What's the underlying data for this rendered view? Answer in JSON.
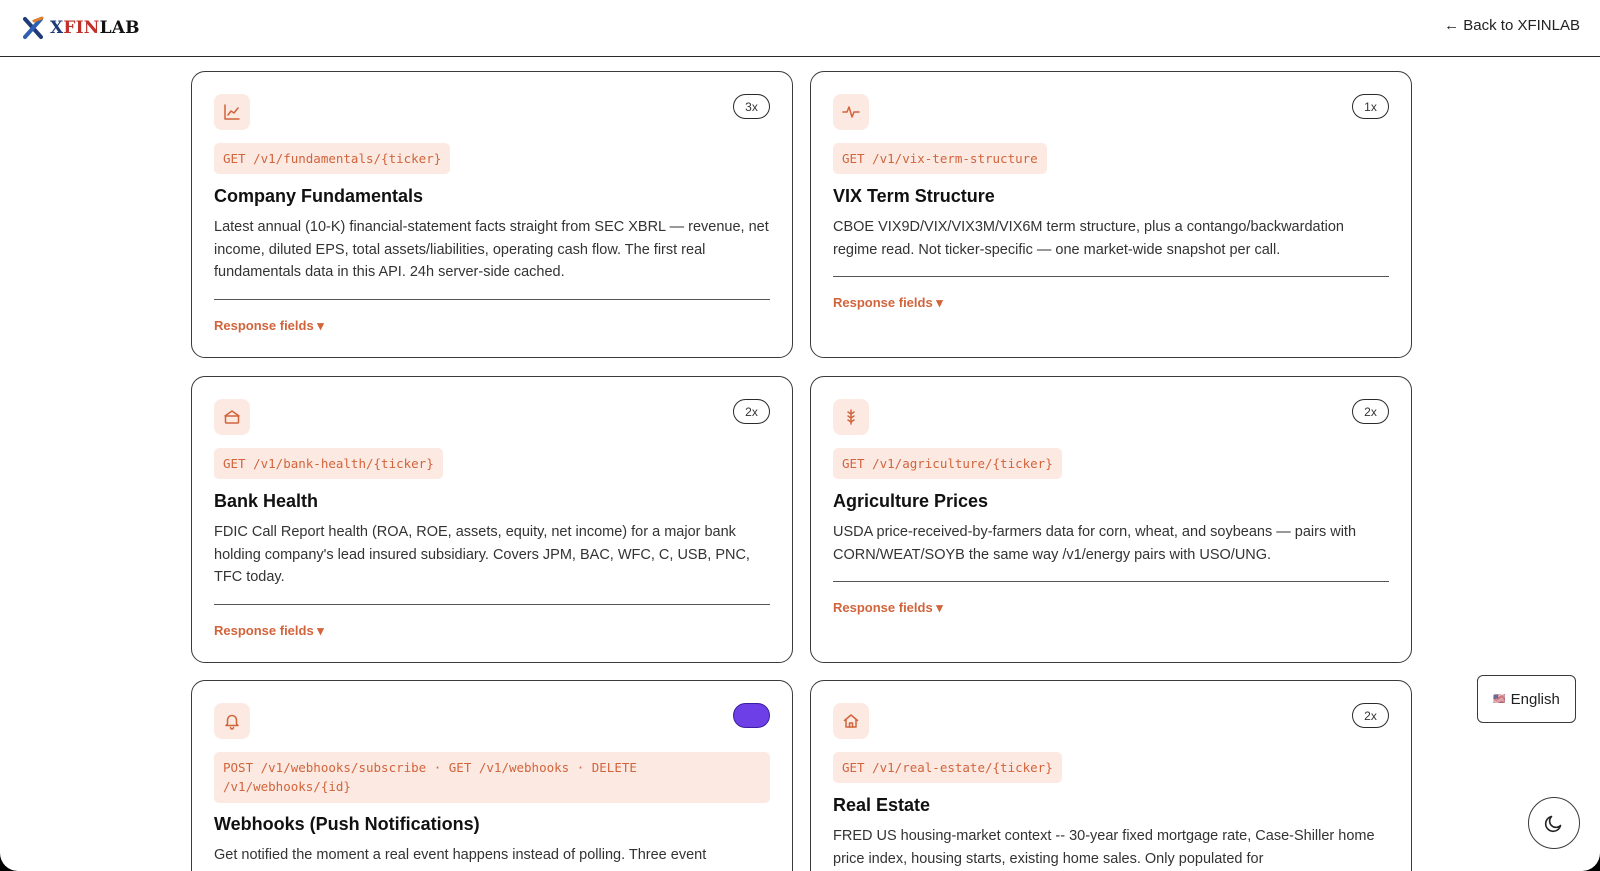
{
  "brand": {
    "name": "XFINLAB"
  },
  "nav": {
    "back_label": "← Back to XFINLAB"
  },
  "cards": [
    {
      "icon": "line-chart-icon",
      "badge": "3x",
      "endpoint": "GET /v1/fundamentals/{ticker}",
      "title": "Company Fundamentals",
      "description": "Latest annual (10-K) financial-statement facts straight from SEC XBRL — revenue, net income, diluted EPS, total assets/liabilities, operating cash flow. The first real fundamentals data in this API. 24h server-side cached.",
      "response_label": "Response fields ▾"
    },
    {
      "icon": "pulse-icon",
      "badge": "1x",
      "endpoint": "GET /v1/vix-term-structure",
      "title": "VIX Term Structure",
      "description": "CBOE VIX9D/VIX/VIX3M/VIX6M term structure, plus a contango/backwardation regime read. Not ticker-specific — one market-wide snapshot per call.",
      "response_label": "Response fields ▾"
    },
    {
      "icon": "bank-icon",
      "badge": "2x",
      "endpoint": "GET /v1/bank-health/{ticker}",
      "title": "Bank Health",
      "description": "FDIC Call Report health (ROA, ROE, assets, equity, net income) for a major bank holding company's lead insured subsidiary. Covers JPM, BAC, WFC, C, USB, PNC, TFC today.",
      "response_label": "Response fields ▾"
    },
    {
      "icon": "wheat-icon",
      "badge": "2x",
      "endpoint": "GET /v1/agriculture/{ticker}",
      "title": "Agriculture Prices",
      "description": "USDA price-received-by-farmers data for corn, wheat, and soybeans — pairs with CORN/WEAT/SOYB the same way /v1/energy pairs with USO/UNG.",
      "response_label": "Response fields ▾"
    },
    {
      "icon": "bell-icon",
      "badge": "",
      "endpoint": "POST /v1/webhooks/subscribe · GET /v1/webhooks · DELETE /v1/webhooks/{id}",
      "title": "Webhooks (Push Notifications)",
      "description": "Get notified the moment a real event happens instead of polling. Three event",
      "response_label": ""
    },
    {
      "icon": "house-icon",
      "badge": "2x",
      "endpoint": "GET /v1/real-estate/{ticker}",
      "title": "Real Estate",
      "description": "FRED US housing-market context -- 30-year fixed mortgage rate, Case-Shiller home price index, housing starts, existing home sales. Only populated for",
      "response_label": ""
    }
  ],
  "language": {
    "flag": "🇺🇸",
    "label": "English"
  },
  "theme_toggle": {
    "icon": "moon-icon"
  },
  "colors": {
    "accent": "#d2643c",
    "accent_bg": "#fbe9e2",
    "badge_purple": "#6d3fe6"
  }
}
